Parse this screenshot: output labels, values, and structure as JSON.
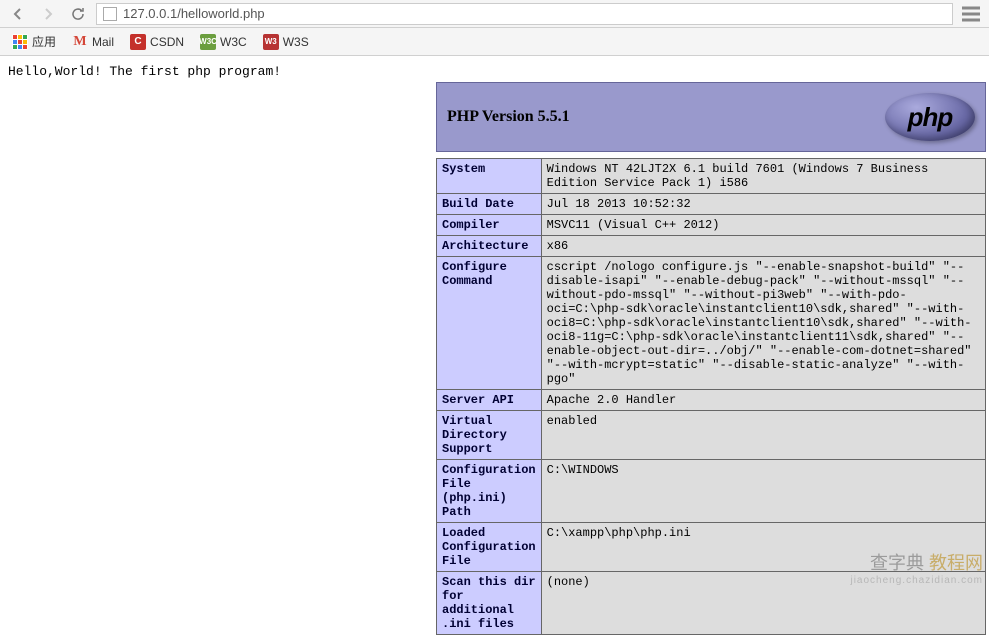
{
  "browser": {
    "url": "127.0.0.1/helloworld.php"
  },
  "bookmarks": {
    "apps": "应用",
    "mail": "Mail",
    "csdn": "CSDN",
    "w3c": "W3C",
    "w3s": "W3S"
  },
  "page": {
    "hello": "Hello,World! The first php program!"
  },
  "phpinfo": {
    "title": "PHP Version 5.5.1",
    "logo_text": "php",
    "rows": [
      {
        "label": "System",
        "value": "Windows NT 42LJT2X 6.1 build 7601 (Windows 7 Business Edition Service Pack 1) i586"
      },
      {
        "label": "Build Date",
        "value": "Jul 18 2013 10:52:32"
      },
      {
        "label": "Compiler",
        "value": "MSVC11 (Visual C++ 2012)"
      },
      {
        "label": "Architecture",
        "value": "x86"
      },
      {
        "label": "Configure Command",
        "value": "cscript /nologo configure.js \"--enable-snapshot-build\" \"--disable-isapi\" \"--enable-debug-pack\" \"--without-mssql\" \"--without-pdo-mssql\" \"--without-pi3web\" \"--with-pdo-oci=C:\\php-sdk\\oracle\\instantclient10\\sdk,shared\" \"--with-oci8=C:\\php-sdk\\oracle\\instantclient10\\sdk,shared\" \"--with-oci8-11g=C:\\php-sdk\\oracle\\instantclient11\\sdk,shared\" \"--enable-object-out-dir=../obj/\" \"--enable-com-dotnet=shared\" \"--with-mcrypt=static\" \"--disable-static-analyze\" \"--with-pgo\""
      },
      {
        "label": "Server API",
        "value": "Apache 2.0 Handler"
      },
      {
        "label": "Virtual Directory Support",
        "value": "enabled"
      },
      {
        "label": "Configuration File (php.ini) Path",
        "value": "C:\\WINDOWS"
      },
      {
        "label": "Loaded Configuration File",
        "value": "C:\\xampp\\php\\php.ini"
      },
      {
        "label": "Scan this dir for additional .ini files",
        "value": "(none)"
      }
    ]
  },
  "watermark": {
    "line1a": "查字典",
    "line1b": "教程网",
    "line2": "jiaocheng.chazidian.com"
  }
}
